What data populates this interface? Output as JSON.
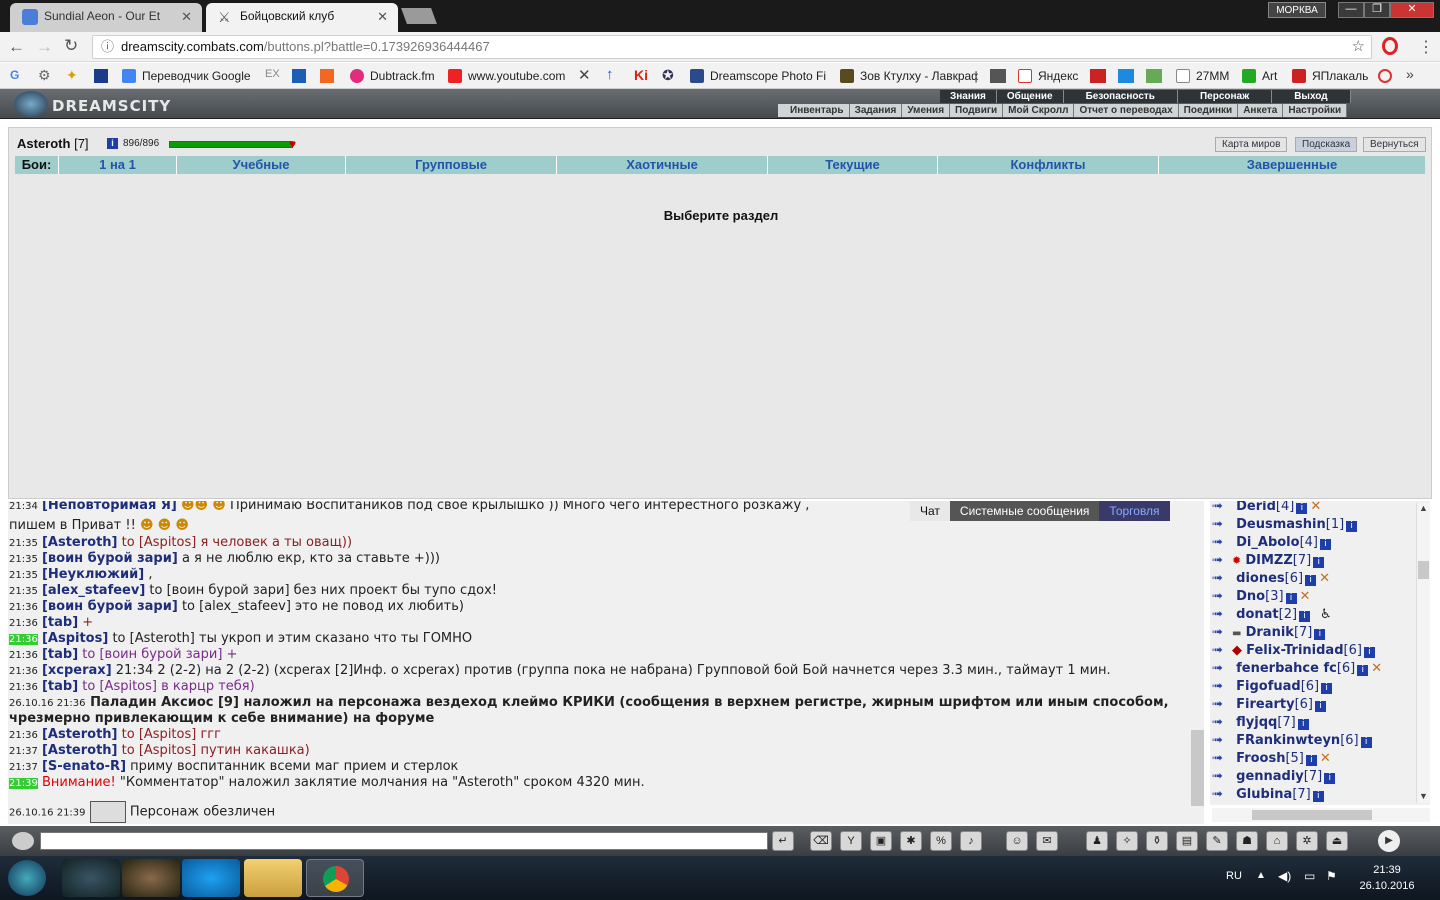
{
  "browser": {
    "tabs": [
      {
        "title": "Sundial Aeon - Our Et",
        "active": false
      },
      {
        "title": "Бойцовский клуб",
        "active": true
      }
    ],
    "profile": "МОРКВА",
    "url_host": "dreamscity.combats.com",
    "url_rest": "/buttons.pl?battle=0.173926936444467",
    "bookmarks": [
      {
        "label": "Переводчик Google"
      },
      {
        "label": "Dubtrack.fm"
      },
      {
        "label": "www.youtube.com"
      },
      {
        "label": "Dreamscope Photo Fi"
      },
      {
        "label": "Зов Ктулху - Лавкраф"
      },
      {
        "label": "Яндекс"
      },
      {
        "label": "27ММ"
      },
      {
        "label": "Art"
      },
      {
        "label": "ЯПлакаль"
      }
    ]
  },
  "game": {
    "logo": "DREAMSCITY",
    "menu_top": [
      "Знания",
      "Общение",
      "Безопасность",
      "Персонаж",
      "Выход"
    ],
    "menu_sub": [
      "Инвентарь",
      "Задания",
      "Умения",
      "Подвиги",
      "Мой Скролл",
      "Отчет о переводах",
      "Поединки",
      "Анкета",
      "Настройки"
    ],
    "character": {
      "name": "Asteroth",
      "level": "[7]",
      "hp": "896/896",
      "hp_fraction": 1.0
    },
    "top_links": [
      "Карта миров",
      "Подсказка",
      "Вернуться"
    ],
    "battle_tabs_label": "Бои:",
    "battle_tabs": [
      "1 на 1",
      "Учебные",
      "Групповые",
      "Хаотичные",
      "Текущие",
      "Конфликты",
      "Завершенные"
    ],
    "select_prompt": "Выберите раздел"
  },
  "chat": {
    "tabs": [
      "Чат",
      "Системные сообщения",
      "Торговля"
    ],
    "lines": [
      {
        "time": "21:34",
        "nick": "[Неповторимая Я]",
        "text": "Принимаю Воспитаников под свое крылышко )) Много чего интерестного розкажу ,"
      },
      {
        "time": "",
        "nick": "",
        "text": "пишем в Приват !!"
      },
      {
        "time": "21:35",
        "nick": "[Asteroth]",
        "text": "to [Aspitos] я человек а ты оващ))"
      },
      {
        "time": "21:35",
        "nick": "[воин бурой зари]",
        "text": "а я не люблю екр, кто за ставьте +)))"
      },
      {
        "time": "21:35",
        "nick": "[Неуклюжий]",
        "text": ","
      },
      {
        "time": "21:35",
        "nick": "[alex_stafeev]",
        "text": "to [воин бурой зари] без них проект бы тупо сдох!"
      },
      {
        "time": "21:36",
        "nick": "[воин бурой зари]",
        "text": "to [alex_stafeev] это не повод их любить)"
      },
      {
        "time": "21:36",
        "nick": "[tab]",
        "text": "+"
      },
      {
        "time": "21:36",
        "nick": "[Aspitos]",
        "text": "to [Asteroth] ты укроп и этим сказано что ты ГОМНО"
      },
      {
        "time": "21:36",
        "nick": "[tab]",
        "text": "to [воин бурой зари] +"
      },
      {
        "time": "21:36",
        "nick": "[xcperax]",
        "text": "21:34 2 (2-2) на 2 (2-2) (xcperax [2]Инф. о xcperax) против (группа пока не набрана) Групповой бой Бой начнется через 3.3 мин., таймаут 1 мин."
      },
      {
        "time": "21:36",
        "nick": "[tab]",
        "text": "to [Aspitos] в карцр тебя)"
      },
      {
        "time": "26.10.16 21:36",
        "nick": "",
        "text": "Паладин Аксиос [9] наложил на персонажа вездеход клеймо КРИКИ (сообщения в верхнем регистре, жирным шрифтом или иным способом,"
      },
      {
        "time": "",
        "nick": "",
        "text": "чрезмерно привлекающим к себе внимание) на форуме"
      },
      {
        "time": "21:36",
        "nick": "[Asteroth]",
        "text": "to [Aspitos] ггг"
      },
      {
        "time": "21:37",
        "nick": "[Asteroth]",
        "text": "to [Aspitos] путин какашка)"
      },
      {
        "time": "21:37",
        "nick": "[S-enato-R]",
        "text": "приму воспитанник всеми маг прием и стерлок"
      },
      {
        "time": "21:39",
        "nick": "Внимание!",
        "text": "\"Комментатор\" наложил заклятие молчания на \"Asteroth\" сроком 4320 мин."
      },
      {
        "time": "26.10.16 21:39",
        "nick": "",
        "text": "Персонаж обезличен"
      }
    ]
  },
  "players": [
    {
      "name": "Derid",
      "level": "[4]"
    },
    {
      "name": "Deusmashin",
      "level": "[1]"
    },
    {
      "name": "Di_Abolo",
      "level": "[4]"
    },
    {
      "name": "DIMZZ",
      "level": "[7]"
    },
    {
      "name": "diones",
      "level": "[6]"
    },
    {
      "name": "Dno",
      "level": "[3]"
    },
    {
      "name": "donat",
      "level": "[2]"
    },
    {
      "name": "Dranik",
      "level": "[7]"
    },
    {
      "name": "Felix-Trinidad",
      "level": "[6]"
    },
    {
      "name": "fenerbahce fc",
      "level": "[6]"
    },
    {
      "name": "Figofuad",
      "level": "[6]"
    },
    {
      "name": "Firearty",
      "level": "[6]"
    },
    {
      "name": "flyjqq",
      "level": "[7]"
    },
    {
      "name": "FRankinwteyn",
      "level": "[6]"
    },
    {
      "name": "Froosh",
      "level": "[5]"
    },
    {
      "name": "gennadiy",
      "level": "[7]"
    },
    {
      "name": "Glubina",
      "level": "[7]"
    }
  ],
  "taskbar": {
    "lang": "RU",
    "time": "21:39",
    "date": "26.10.2016"
  },
  "colors": {
    "accent": "#9fcdcb",
    "link": "#2255aa",
    "hp": "#0a9a0a"
  }
}
